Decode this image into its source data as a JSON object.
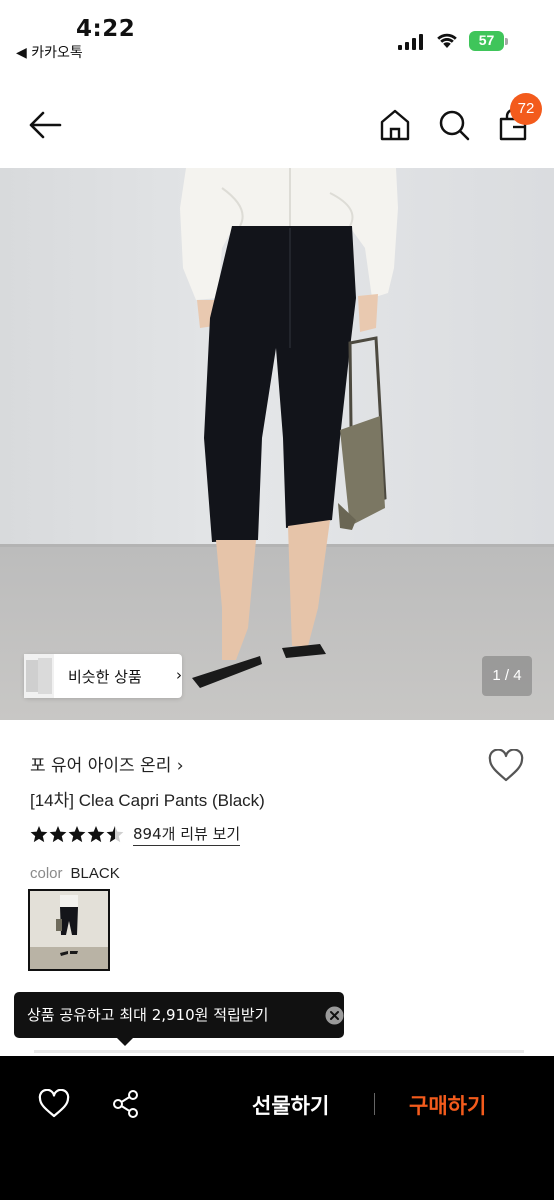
{
  "status_bar": {
    "time": "4:22",
    "back_app": "◀ 카카오톡",
    "battery": "57"
  },
  "header": {
    "cart_count": "72"
  },
  "gallery": {
    "similar_label": "비슷한 상품",
    "page_indicator": "1 / 4"
  },
  "product": {
    "brand": "포 유어 아이즈 온리 ›",
    "title": "[14차] Clea Capri Pants (Black)",
    "rating": 4.5,
    "review_link": "894개 리뷰 보기",
    "color_label": "color",
    "color_value": "BLACK"
  },
  "tooltip": {
    "text": "상품 공유하고 최대 2,910원 적립받기"
  },
  "bottom_bar": {
    "gift_label": "선물하기",
    "buy_label": "구매하기"
  },
  "colors": {
    "accent": "#f35b1c",
    "bottom_bar_bg": "#000000",
    "battery": "#3fc55a"
  }
}
